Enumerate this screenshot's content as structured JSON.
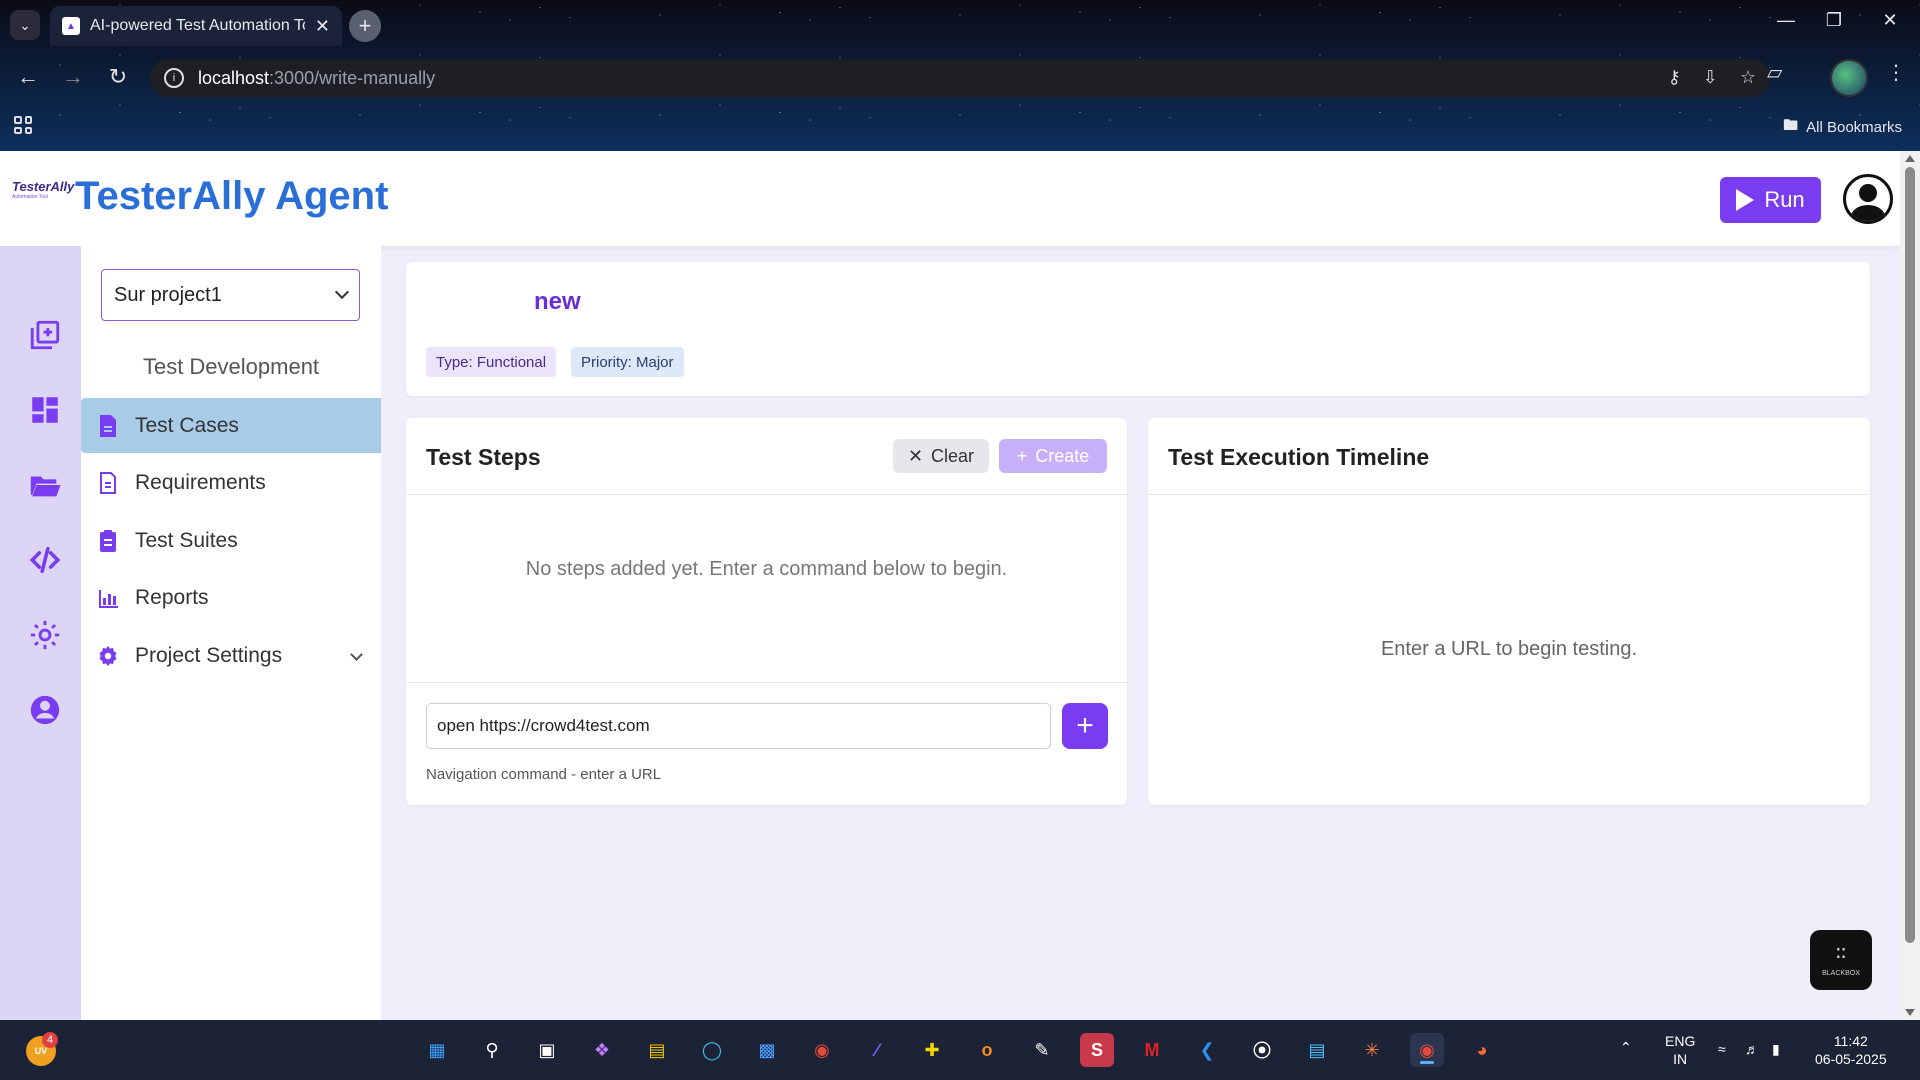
{
  "browser": {
    "tab_title": "AI-powered Test Automation To",
    "url_host": "localhost",
    "url_path": ":3000/write-manually",
    "all_bookmarks": "All Bookmarks"
  },
  "app": {
    "brand": "TesterAlly Agent",
    "logo_text": "TesterAlly",
    "logo_sub": "Automation Tool",
    "run_label": "Run"
  },
  "sidebar": {
    "project": "Sur project1",
    "section_title": "Test Development",
    "items": [
      {
        "label": "Test Cases",
        "icon": "file-icon",
        "active": true
      },
      {
        "label": "Requirements",
        "icon": "document-icon",
        "active": false
      },
      {
        "label": "Test Suites",
        "icon": "clipboard-icon",
        "active": false
      },
      {
        "label": "Reports",
        "icon": "chart-icon",
        "active": false
      },
      {
        "label": "Project Settings",
        "icon": "gear-icon",
        "active": false
      }
    ]
  },
  "rail": [
    "add-box-icon",
    "dashboard-icon",
    "folder-open-icon",
    "code-icon",
    "settings-icon",
    "account-icon"
  ],
  "test_case": {
    "name": "new",
    "type_tag": "Type: Functional",
    "priority_tag": "Priority: Major"
  },
  "steps": {
    "title": "Test Steps",
    "clear_label": "Clear",
    "create_label": "Create",
    "empty_message": "No steps added yet. Enter a command below to begin.",
    "command_value": "open https://crowd4test.com",
    "hint": "Navigation command - enter a URL"
  },
  "timeline": {
    "title": "Test Execution Timeline",
    "empty_message": "Enter a URL to begin testing."
  },
  "blackbox": "BLACKBOX",
  "taskbar": {
    "weather_badge": "4",
    "weather_text": "UV",
    "lang": "ENG",
    "region": "IN",
    "time": "11:42",
    "date": "06-05-2025"
  },
  "colors": {
    "accent": "#7a3cf0",
    "brand": "#2a6fd8",
    "active_item": "#a8cce8"
  }
}
